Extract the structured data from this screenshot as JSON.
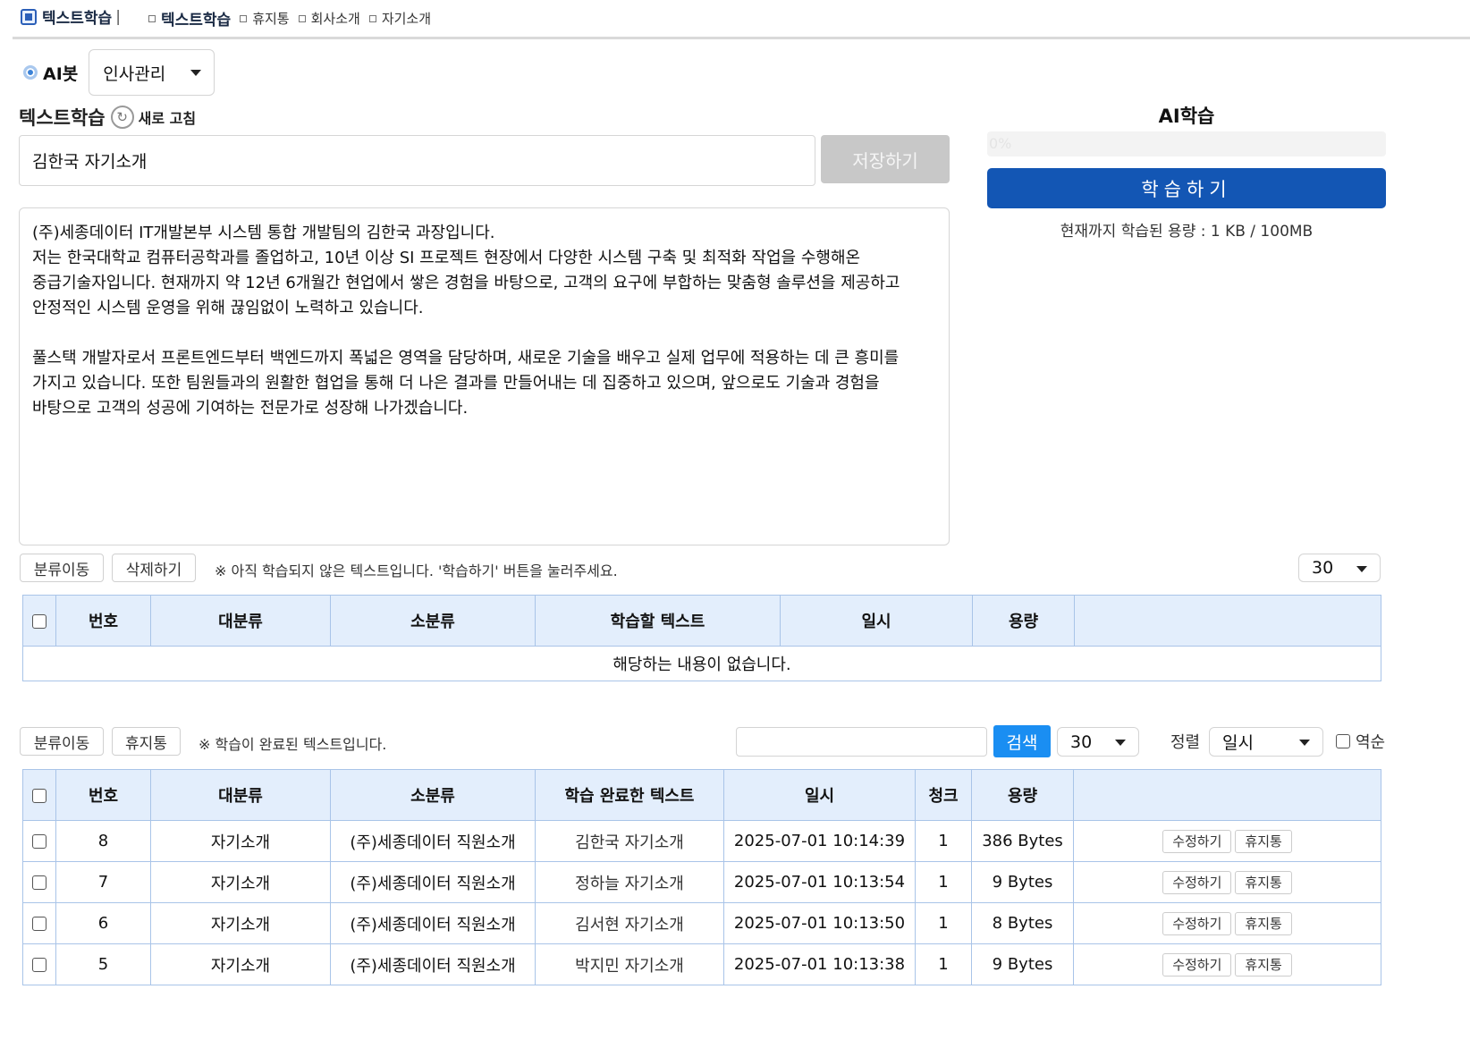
{
  "header": {
    "app_title": "텍스트학습",
    "crumbs": [
      "텍스트학습",
      "휴지통",
      "회사소개",
      "자기소개"
    ]
  },
  "bot": {
    "label": "AI봇",
    "category_value": "인사관리"
  },
  "editor": {
    "section_title": "텍스트학습",
    "refresh_label": "새로 고침",
    "title_value": "김한국 자기소개",
    "save_label": "저장하기",
    "body": "(주)세종데이터 IT개발본부 시스템 통합 개발팀의 김한국 과장입니다.\n저는 한국대학교 컴퓨터공학과를 졸업하고, 10년 이상 SI 프로젝트 현장에서 다양한 시스템 구축 및 최적화 작업을 수행해온 중급기술자입니다. 현재까지 약 12년 6개월간 현업에서 쌓은 경험을 바탕으로, 고객의 요구에 부합하는 맞춤형 솔루션을 제공하고 안정적인 시스템 운영을 위해 끊임없이 노력하고 있습니다.\n\n풀스택 개발자로서 프론트엔드부터 백엔드까지 폭넓은 영역을 담당하며, 새로운 기술을 배우고 실제 업무에 적용하는 데 큰 흥미를 가지고 있습니다. 또한 팀원들과의 원활한 협업을 통해 더 나은 결과를 만들어내는 데 집중하고 있으며, 앞으로도 기술과 경험을 바탕으로 고객의 성공에 기여하는 전문가로 성장해 나가겠습니다."
  },
  "ai": {
    "title": "AI학습",
    "progress_label": "0%",
    "progress_fraction": 0,
    "learn_label": "학습하기",
    "usage_text": "현재까지 학습된 용량 : 1 KB / 100MB"
  },
  "pending": {
    "move_label": "분류이동",
    "delete_label": "삭제하기",
    "note": "※ 아직 학습되지 않은 텍스트입니다. '학습하기' 버튼을 눌러주세요.",
    "page_size": "30",
    "headers": [
      "번호",
      "대분류",
      "소분류",
      "학습할 텍스트",
      "일시",
      "용량"
    ],
    "empty_text": "해당하는 내용이 없습니다."
  },
  "done": {
    "move_label": "분류이동",
    "trash_label": "휴지통",
    "note": "※ 학습이 완료된 텍스트입니다.",
    "search_placeholder": "",
    "search_label": "검색",
    "page_size": "30",
    "sort_label": "정렬",
    "sort_value": "일시",
    "reverse_label": "역순",
    "headers": [
      "번호",
      "대분류",
      "소분류",
      "학습 완료한 텍스트",
      "일시",
      "청크",
      "용량"
    ],
    "edit_label": "수정하기",
    "row_trash_label": "휴지통",
    "rows": [
      {
        "no": "8",
        "major": "자기소개",
        "minor": "(주)세종데이터 직원소개",
        "text": "김한국 자기소개",
        "date": "2025-07-01 10:14:39",
        "chunk": "1",
        "size": "386 Bytes"
      },
      {
        "no": "7",
        "major": "자기소개",
        "minor": "(주)세종데이터 직원소개",
        "text": "정하늘 자기소개",
        "date": "2025-07-01 10:13:54",
        "chunk": "1",
        "size": "9 Bytes"
      },
      {
        "no": "6",
        "major": "자기소개",
        "minor": "(주)세종데이터 직원소개",
        "text": "김서현 자기소개",
        "date": "2025-07-01 10:13:50",
        "chunk": "1",
        "size": "8 Bytes"
      },
      {
        "no": "5",
        "major": "자기소개",
        "minor": "(주)세종데이터 직원소개",
        "text": "박지민 자기소개",
        "date": "2025-07-01 10:13:38",
        "chunk": "1",
        "size": "9 Bytes"
      }
    ]
  },
  "colors": {
    "primary": "#1356b4",
    "search": "#1a8ef2",
    "table_header": "#e3eefc",
    "table_border": "#a9c4e8",
    "save_disabled": "#c8c8c8"
  }
}
